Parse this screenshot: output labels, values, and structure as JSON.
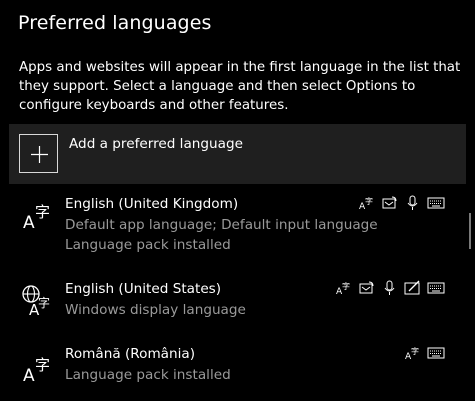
{
  "heading": "Preferred languages",
  "description": "Apps and websites will appear in the first language in the list that they support. Select a language and then select Options to configure keyboards and other features.",
  "add_language": {
    "label": "Add a preferred language",
    "icon": "plus-icon"
  },
  "languages": [
    {
      "name": "English (United Kingdom)",
      "details": [
        "Default app language; Default input language",
        "Language pack installed"
      ],
      "icon": "language-icon",
      "features": [
        "display-language-icon",
        "text-to-speech-icon",
        "speech-recognition-icon",
        "keyboard-icon"
      ]
    },
    {
      "name": "English (United States)",
      "details": [
        "Windows display language"
      ],
      "icon": "windows-display-language-icon",
      "features": [
        "display-language-icon",
        "text-to-speech-icon",
        "speech-recognition-icon",
        "handwriting-icon",
        "keyboard-icon"
      ]
    },
    {
      "name": "Română (România)",
      "details": [
        "Language pack installed"
      ],
      "icon": "language-icon",
      "features": [
        "display-language-icon",
        "keyboard-icon"
      ]
    }
  ],
  "colors": {
    "background": "#000000",
    "row_highlight": "#1f1f1f",
    "secondary_text": "#9a9a9a",
    "primary_text": "#ffffff"
  }
}
